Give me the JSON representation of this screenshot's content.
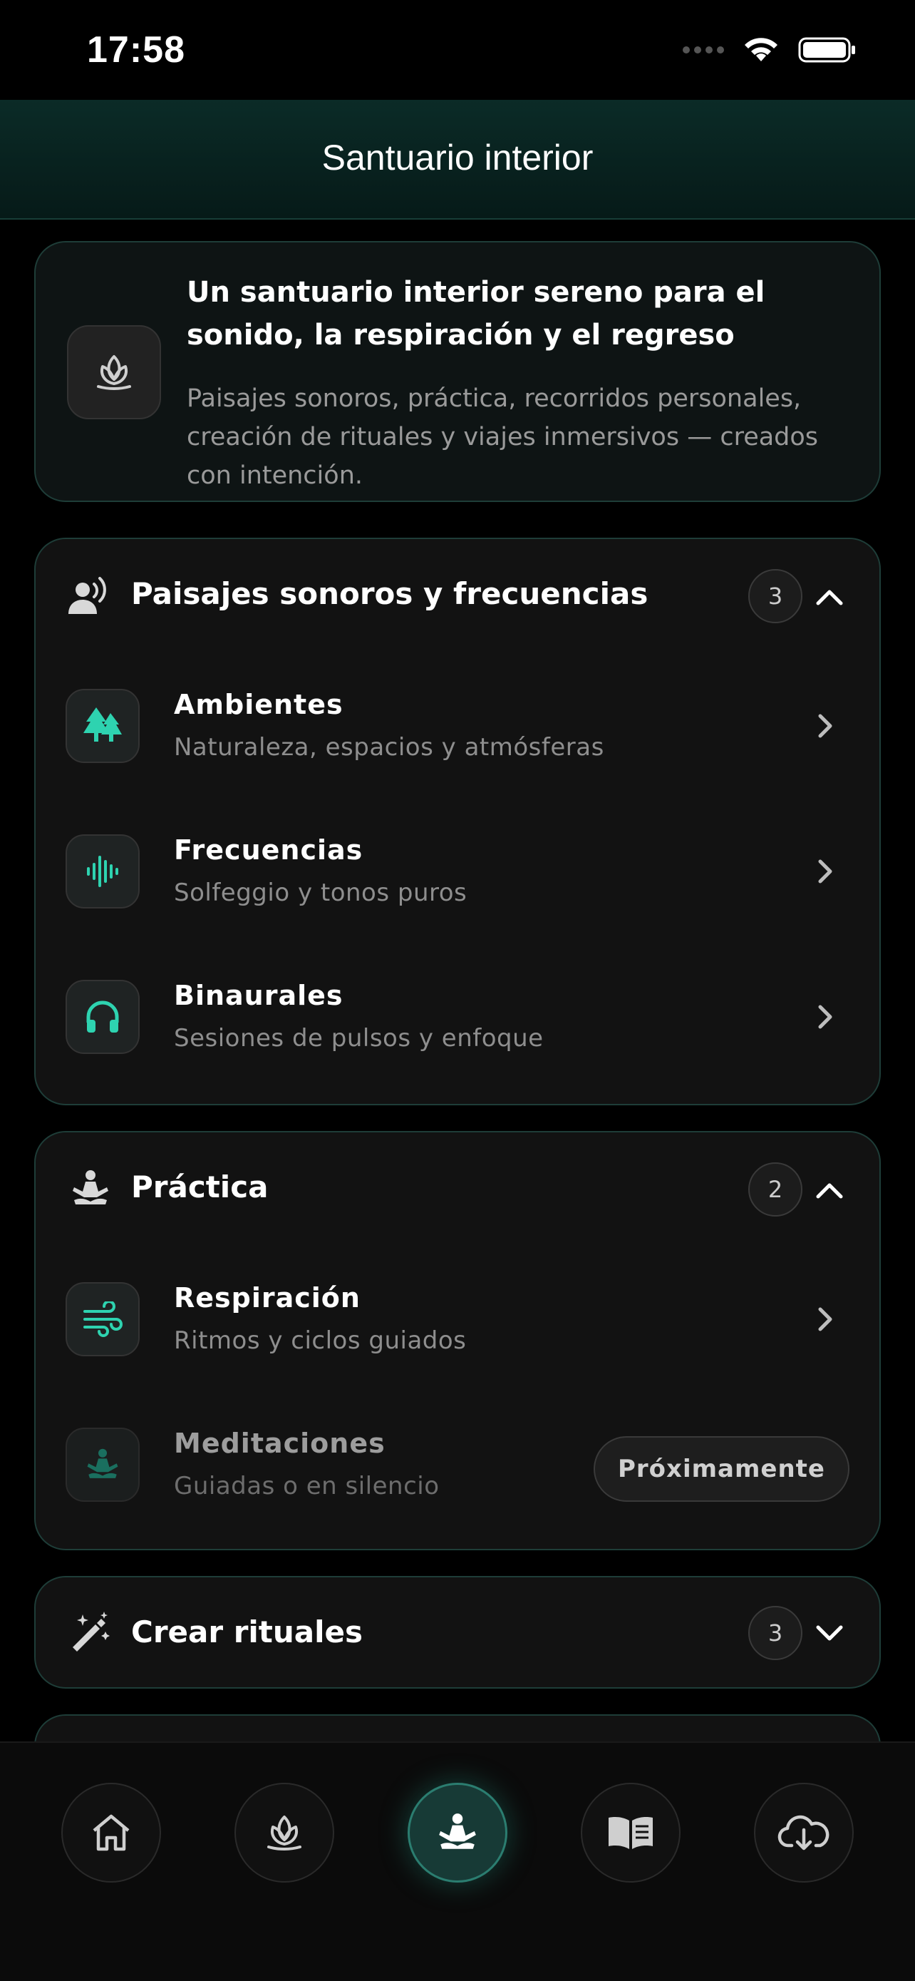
{
  "status_bar": {
    "time": "17:58"
  },
  "header": {
    "title": "Santuario interior"
  },
  "intro": {
    "title": "Un santuario interior sereno para el sonido, la respiración y el regreso",
    "description": "Paisajes sonoros, práctica, recorridos personales, creación de rituales y viajes inmersivos — creados con intención.",
    "icon": "lotus-icon"
  },
  "sections": [
    {
      "title": "Paisajes sonoros y frecuencias",
      "count": "3",
      "icon": "person-sound-icon",
      "expanded": true,
      "items": [
        {
          "title": "Ambientes",
          "subtitle": "Naturaleza, espacios y atmósferas",
          "icon": "trees-icon"
        },
        {
          "title": "Frecuencias",
          "subtitle": "Solfeggio y tonos puros",
          "icon": "waveform-icon"
        },
        {
          "title": "Binaurales",
          "subtitle": "Sesiones de pulsos y enfoque",
          "icon": "headphones-icon"
        }
      ]
    },
    {
      "title": "Práctica",
      "count": "2",
      "icon": "meditation-icon",
      "expanded": true,
      "items": [
        {
          "title": "Respiración",
          "subtitle": "Ritmos y ciclos guiados",
          "icon": "wind-icon"
        },
        {
          "title": "Meditaciones",
          "subtitle": "Guiadas o en silencio",
          "icon": "meditation-icon",
          "badge": "Próximamente"
        }
      ]
    },
    {
      "title": "Crear rituales",
      "count": "3",
      "icon": "magic-wand-icon",
      "expanded": false
    }
  ],
  "bottom_nav": [
    {
      "icon": "home-icon"
    },
    {
      "icon": "lotus-icon"
    },
    {
      "icon": "meditation-icon",
      "active": true
    },
    {
      "icon": "book-icon"
    },
    {
      "icon": "cloud-download-icon"
    }
  ],
  "colors": {
    "accent": "#2ed3b0",
    "card_border": "#1e3d38",
    "background": "#000000"
  }
}
